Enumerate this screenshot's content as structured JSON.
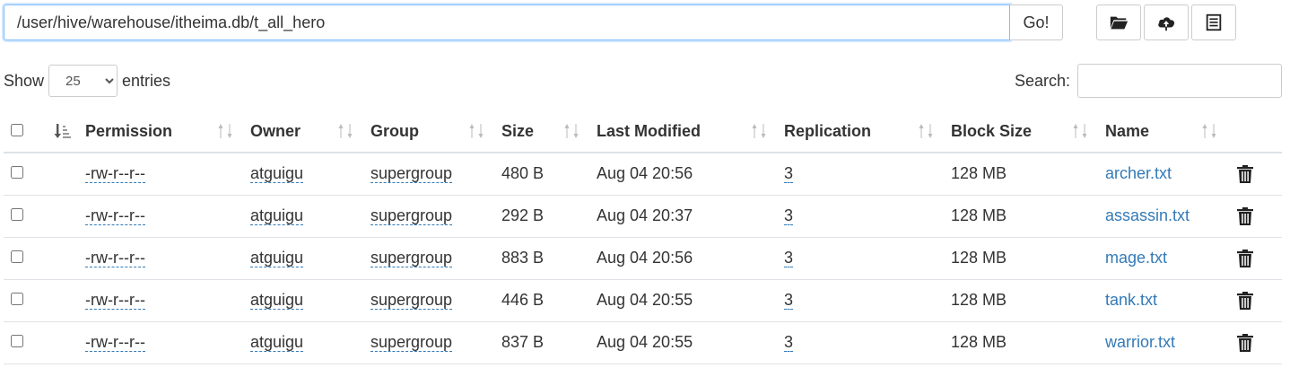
{
  "path_bar": {
    "value": "/user/hive/warehouse/itheima.db/t_all_hero",
    "go_label": "Go!"
  },
  "toolbar": {
    "icons": [
      "folder-icon",
      "cloud-upload-icon",
      "list-icon"
    ]
  },
  "length": {
    "show_label": "Show",
    "selected": "25",
    "entries_label": "entries"
  },
  "search": {
    "label": "Search:"
  },
  "table": {
    "columns": [
      "Permission",
      "Owner",
      "Group",
      "Size",
      "Last Modified",
      "Replication",
      "Block Size",
      "Name"
    ],
    "rows": [
      {
        "permission": "-rw-r--r--",
        "owner": "atguigu",
        "group": "supergroup",
        "size": "480 B",
        "modified": "Aug 04 20:56",
        "replication": "3",
        "block_size": "128 MB",
        "name": "archer.txt"
      },
      {
        "permission": "-rw-r--r--",
        "owner": "atguigu",
        "group": "supergroup",
        "size": "292 B",
        "modified": "Aug 04 20:37",
        "replication": "3",
        "block_size": "128 MB",
        "name": "assassin.txt"
      },
      {
        "permission": "-rw-r--r--",
        "owner": "atguigu",
        "group": "supergroup",
        "size": "883 B",
        "modified": "Aug 04 20:56",
        "replication": "3",
        "block_size": "128 MB",
        "name": "mage.txt"
      },
      {
        "permission": "-rw-r--r--",
        "owner": "atguigu",
        "group": "supergroup",
        "size": "446 B",
        "modified": "Aug 04 20:55",
        "replication": "3",
        "block_size": "128 MB",
        "name": "tank.txt"
      },
      {
        "permission": "-rw-r--r--",
        "owner": "atguigu",
        "group": "supergroup",
        "size": "837 B",
        "modified": "Aug 04 20:55",
        "replication": "3",
        "block_size": "128 MB",
        "name": "warrior.txt"
      }
    ]
  },
  "colors": {
    "link": "#337ab7",
    "border": "#dee2e6",
    "focus": "#80bdff"
  }
}
